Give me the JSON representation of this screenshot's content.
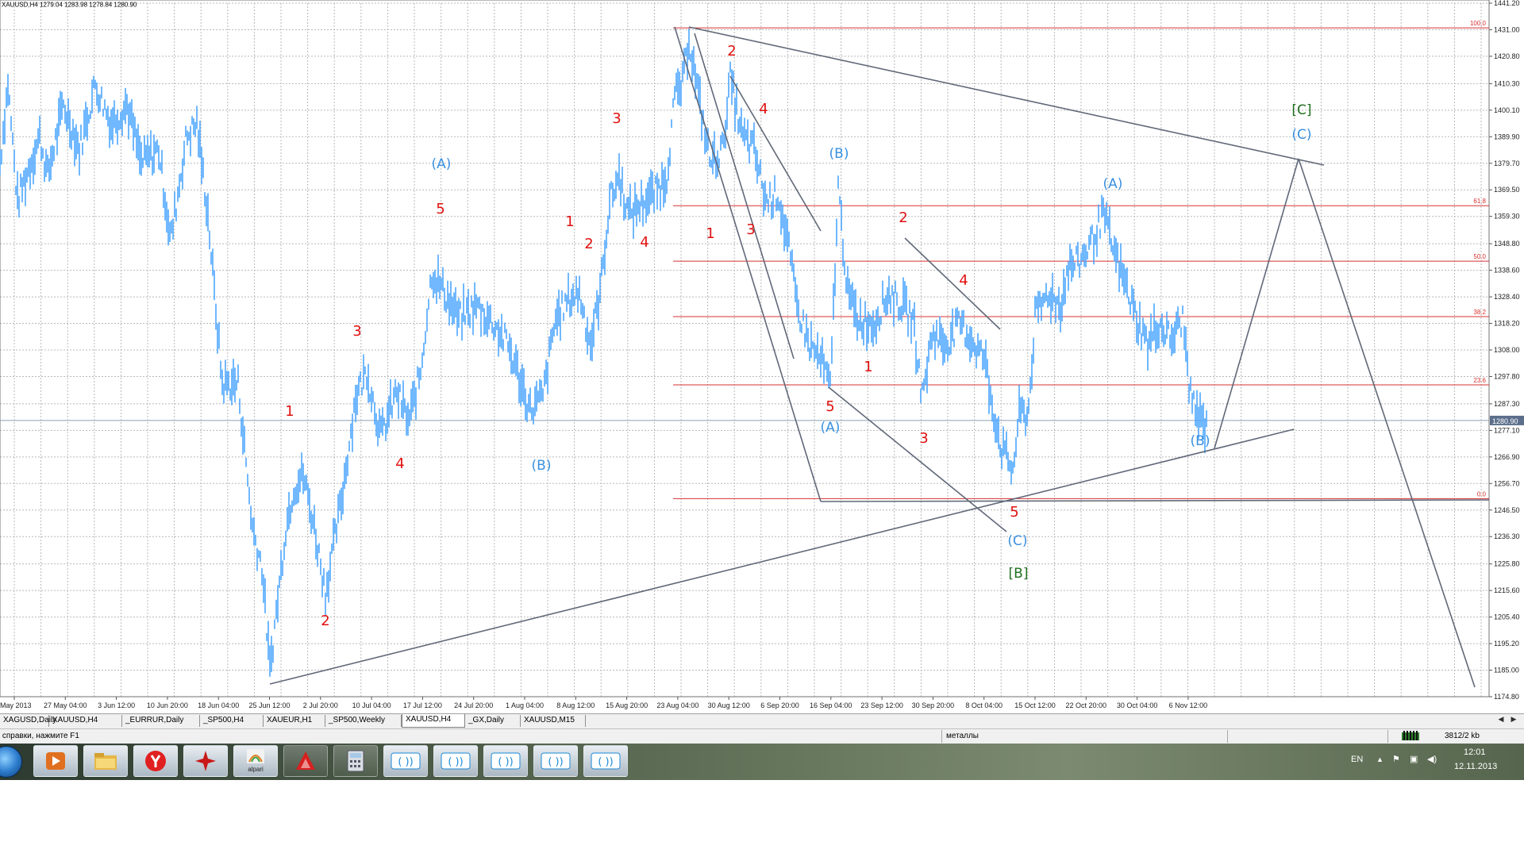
{
  "header_info": "XAUUSD,H4  1279.04 1283.98 1278.84 1280.90",
  "price_axis": [
    "1441.20",
    "1431.00",
    "1420.80",
    "1410.30",
    "1400.10",
    "1389.90",
    "1379.70",
    "1369.50",
    "1359.30",
    "1348.80",
    "1338.60",
    "1328.40",
    "1318.20",
    "1308.00",
    "1297.80",
    "1287.30",
    "1277.10",
    "1266.90",
    "1256.70",
    "1246.50",
    "1236.30",
    "1225.80",
    "1215.60",
    "1205.40",
    "1195.20",
    "1185.00",
    "1174.80"
  ],
  "current_price": "1280.90",
  "time_axis": [
    "May 2013",
    "27 May 04:00",
    "3 Jun 12:00",
    "10 Jun 20:00",
    "18 Jun 04:00",
    "25 Jun 12:00",
    "2 Jul 20:00",
    "10 Jul 04:00",
    "17 Jul 12:00",
    "24 Jul 20:00",
    "1 Aug 04:00",
    "8 Aug 12:00",
    "15 Aug 20:00",
    "23 Aug 04:00",
    "30 Aug 12:00",
    "6 Sep 20:00",
    "16 Sep 04:00",
    "23 Sep 12:00",
    "30 Sep 20:00",
    "8 Oct 04:00",
    "15 Oct 12:00",
    "22 Oct 20:00",
    "30 Oct 04:00",
    "6 Nov 12:00"
  ],
  "fib_labels": [
    "100.0",
    "61.8",
    "50.0",
    "38.2",
    "23.6",
    "0.0"
  ],
  "wave_labels_red": [
    "1",
    "2",
    "3",
    "4",
    "5",
    "1",
    "2",
    "3",
    "4",
    "1",
    "2",
    "3",
    "4",
    "5",
    "1",
    "2",
    "3",
    "4",
    "5"
  ],
  "wave_labels_blue": [
    "(A)",
    "(B)",
    "(B)",
    "(A)",
    "(C)",
    "(A)",
    "(B)",
    "(C)"
  ],
  "wave_labels_green": [
    "[B]",
    "[C]"
  ],
  "chart_data": {
    "type": "line",
    "title": "XAUUSD,H4",
    "ylim": [
      1174.8,
      1441.2
    ],
    "x": [
      "May 2013",
      "27 May 04:00",
      "3 Jun 12:00",
      "10 Jun 20:00",
      "18 Jun 04:00",
      "25 Jun 12:00",
      "2 Jul 20:00",
      "10 Jul 04:00",
      "17 Jul 12:00",
      "24 Jul 20:00",
      "1 Aug 04:00",
      "8 Aug 12:00",
      "15 Aug 20:00",
      "23 Aug 04:00",
      "30 Aug 12:00",
      "6 Sep 20:00",
      "16 Sep 04:00",
      "23 Sep 12:00",
      "30 Sep 20:00",
      "8 Oct 04:00",
      "15 Oct 12:00",
      "22 Oct 20:00",
      "30 Oct 04:00",
      "6 Nov 12:00"
    ],
    "series": [
      {
        "values": [
          1380,
          1405,
          1398,
          1385,
          1330,
          1190,
          1245,
          1290,
          1320,
          1325,
          1282,
          1330,
          1375,
          1405,
          1395,
          1350,
          1300,
          1325,
          1320,
          1298,
          1272,
          1335,
          1345,
          1306
        ]
      }
    ],
    "grid": true
  },
  "tabs": [
    "XAGUSD,Daily",
    "XAUUSD,H4",
    "_EURRUR,Daily",
    "_SP500,H4",
    "XAUEUR,H1",
    "_SP500,Weekly",
    "XAUUSD,H4",
    "_GX,Daily",
    "XAUUSD,M15"
  ],
  "active_tab": "XAUUSD,H4",
  "status": {
    "help": "Для вызова справки, нажмите F1",
    "profile": "металлы",
    "traffic": "3812/2 kb"
  },
  "taskbar": {
    "apps": [
      "media-player",
      "file-explorer",
      "yandex-browser",
      "tool-red-star",
      "alpari",
      "terminal-red-triangle",
      "calculator",
      "metatrader-1",
      "metatrader-2",
      "metatrader-3",
      "metatrader-4",
      "metatrader-5"
    ],
    "alpari_label": "alpari",
    "lang": "EN",
    "time": "12:01",
    "date": "12.11.2013"
  },
  "colors": {
    "price_line": "#4da6ff",
    "grid": "#b8b8b8",
    "fib": "#d93030",
    "trendline": "#606878",
    "wave_red": "#e01010",
    "wave_blue": "#3a90e0",
    "wave_green": "#207020"
  }
}
